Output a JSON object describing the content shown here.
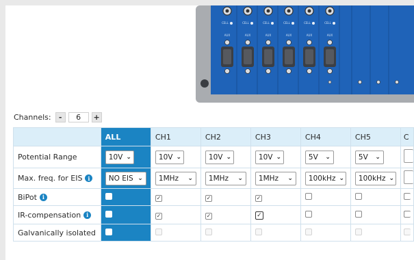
{
  "channels": {
    "label": "Channels:",
    "minus": "-",
    "value": "6",
    "plus": "+"
  },
  "table": {
    "headers": [
      "ALL",
      "CH1",
      "CH2",
      "CH3",
      "CH4",
      "CH5",
      "C"
    ],
    "rows": {
      "potential_range": {
        "label": "Potential Range",
        "all": "10V",
        "ch1": "10V",
        "ch2": "10V",
        "ch3": "10V",
        "ch4": "5V",
        "ch5": "5V"
      },
      "max_freq": {
        "label": "Max. freq. for EIS",
        "all": "NO EIS",
        "ch1": "1MHz",
        "ch2": "1MHz",
        "ch3": "1MHz",
        "ch4": "100kHz",
        "ch5": "100kHz"
      },
      "bipot": {
        "label": "BiPot",
        "ch1": true,
        "ch2": true,
        "ch3": true,
        "ch4": false,
        "ch5": false
      },
      "ir_comp": {
        "label": "IR-compensation",
        "ch1": true,
        "ch2": true,
        "ch3": true,
        "ch4": false,
        "ch5": false
      },
      "galvanic": {
        "label": "Galvanically isolated"
      }
    }
  },
  "icons": {
    "info": "info-circle-icon",
    "dropdown": "chevron-down-icon",
    "check": "checkmark-icon"
  },
  "device": {
    "slot_labels": [
      "CELL",
      "AUX"
    ],
    "color": "#1f63b8"
  },
  "colors": {
    "accent": "#1b84c3",
    "header_bg": "#dbeef9",
    "border": "#cfe0ec"
  }
}
